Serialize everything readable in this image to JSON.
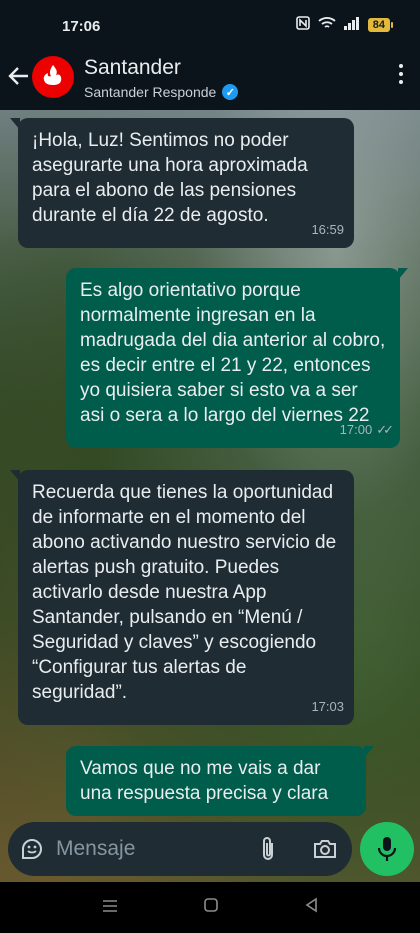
{
  "status_bar": {
    "time": "17:06",
    "battery": "84"
  },
  "header": {
    "title": "Santander",
    "subtitle": "Santander Responde"
  },
  "messages": [
    {
      "direction": "in",
      "text": "¡Hola, Luz! Sentimos no poder asegurarte una hora aproximada para el abono de las pensiones durante el día 22 de agosto.",
      "time": "16:59"
    },
    {
      "direction": "out",
      "text": "Es algo orientativo porque normalmente ingresan en la madrugada del dia anterior al cobro, es decir entre el 21 y 22, entonces yo quisiera saber si esto va a ser asi o sera a lo largo del viernes 22",
      "time": "17:00"
    },
    {
      "direction": "in",
      "text": "Recuerda que tienes la oportunidad de informarte en el momento del abono activando nuestro servicio de alertas push gratuito. Puedes activarlo desde nuestra App Santander, pulsando en “Menú / Seguridad y claves” y escogiendo “Configurar tus alertas de seguridad”.",
      "time": "17:03"
    },
    {
      "direction": "out",
      "text": "Vamos que no me vais a dar una respuesta precisa y clara",
      "time": ""
    }
  ],
  "composer": {
    "placeholder": "Mensaje"
  },
  "colors": {
    "incoming_bubble": "#1f2c34",
    "outgoing_bubble": "#005c4b",
    "accent_green": "#21c063",
    "brand_red": "#ec0000"
  }
}
